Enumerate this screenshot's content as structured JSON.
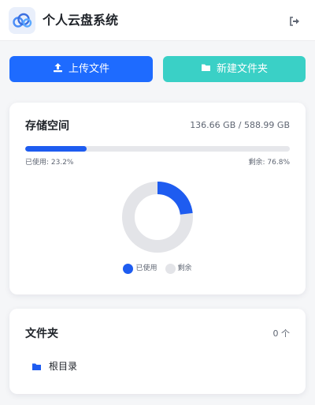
{
  "header": {
    "logo_icon": "cloud-icon",
    "title": "个人云盘系统",
    "logout_icon": "logout-icon"
  },
  "actions": {
    "upload_label": "上传文件",
    "upload_icon": "upload-icon",
    "new_folder_label": "新建文件夹",
    "new_folder_icon": "folder-icon"
  },
  "storage": {
    "title": "存储空间",
    "summary": "136.66 GB / 588.99 GB",
    "used_fraction": 0.232,
    "used_text": "已使用: 23.2%",
    "remaining_text": "剩余: 76.8%",
    "legend": [
      {
        "label": "已使用",
        "color": "#1e5cf0"
      },
      {
        "label": "剩余",
        "color": "#e3e4e8"
      }
    ]
  },
  "folders": {
    "title": "文件夹",
    "count": "0 个",
    "items": [
      {
        "name": "根目录",
        "icon": "folder-icon"
      }
    ]
  },
  "colors": {
    "primary": "#1e6bff",
    "accent": "#3ad0c6",
    "used": "#1e5cf0",
    "remaining": "#e3e4e8"
  }
}
